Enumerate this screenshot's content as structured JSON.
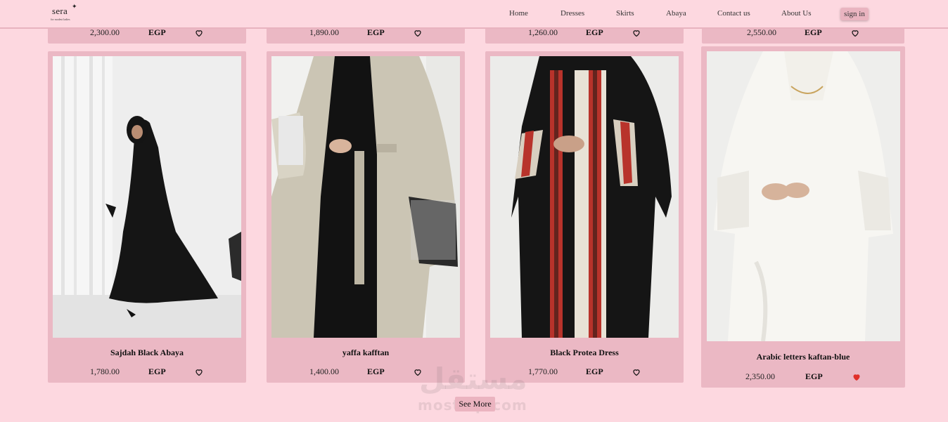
{
  "brand": {
    "name": "sera",
    "tagline": "for modest ladies"
  },
  "nav": {
    "home": "Home",
    "dresses": "Dresses",
    "skirts": "Skirts",
    "abaya": "Abaya",
    "contact": "Contact us",
    "about": "About Us",
    "signin": "sign in"
  },
  "top_row": [
    {
      "price": "2,300.00",
      "currency": "EGP"
    },
    {
      "price": "1,890.00",
      "currency": "EGP"
    },
    {
      "price": "1,260.00",
      "currency": "EGP"
    },
    {
      "price": "2,550.00",
      "currency": "EGP"
    }
  ],
  "products": [
    {
      "name": "Sajdah Black Abaya",
      "price": "1,780.00",
      "currency": "EGP",
      "favorited": false
    },
    {
      "name": "yaffa kafftan",
      "price": "1,400.00",
      "currency": "EGP",
      "favorited": false
    },
    {
      "name": "Black Protea Dress",
      "price": "1,770.00",
      "currency": "EGP",
      "favorited": false
    },
    {
      "name": "Arabic letters kaftan-blue",
      "price": "2,350.00",
      "currency": "EGP",
      "favorited": true
    }
  ],
  "see_more": "See More",
  "watermark": {
    "arabic": "مستقل",
    "latin": "mostaql.com"
  },
  "colors": {
    "page_bg": "#fdd8e0",
    "card_bg": "#ebb8c4",
    "heart_active": "#e0302a"
  }
}
